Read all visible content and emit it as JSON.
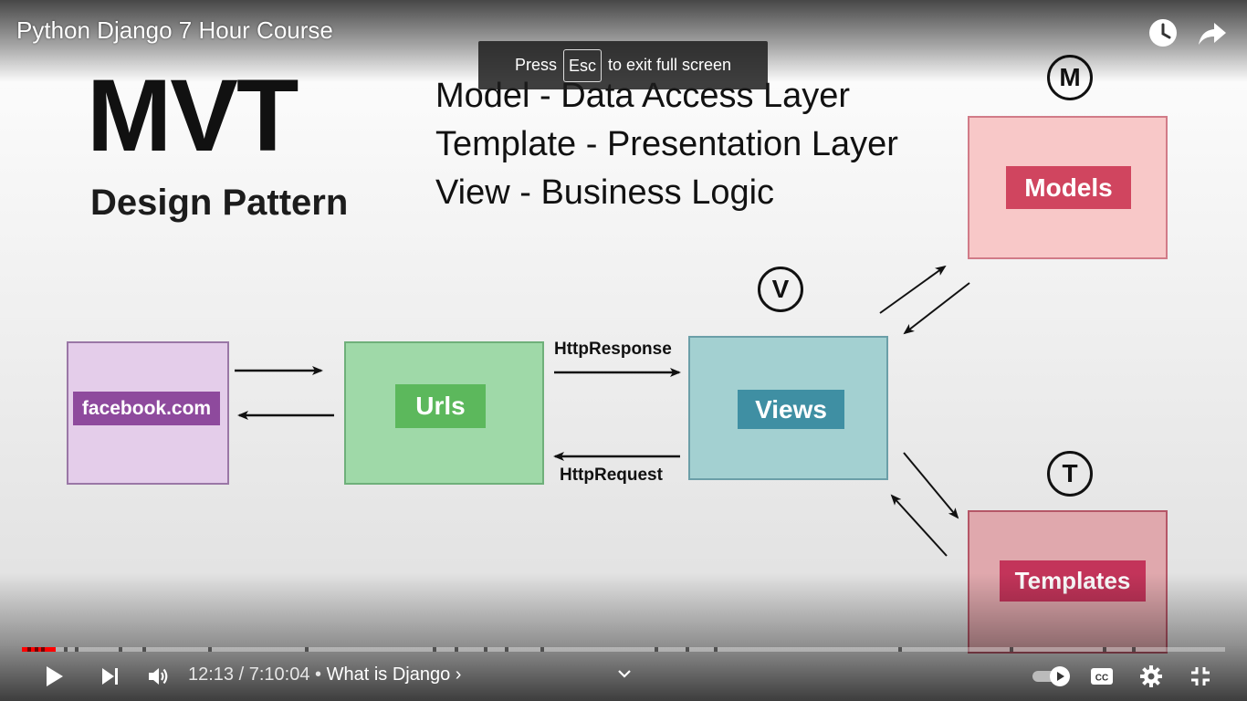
{
  "player": {
    "title": "Python Django 7 Hour Course",
    "fullscreen_toast": {
      "prefix": "Press",
      "key": "Esc",
      "suffix": "to exit full screen"
    },
    "time": {
      "current": "12:13",
      "separator": " / ",
      "total": "7:10:04",
      "bullet": " • ",
      "chapter": "What is Django",
      "chapter_chevron": "›"
    },
    "progress_fraction": 0.0284,
    "accent_color": "#ff0000",
    "icons": {
      "top_right": [
        "watch-later-icon",
        "share-icon"
      ],
      "bottom_left": [
        "play-icon",
        "next-icon",
        "volume-icon"
      ],
      "bottom_right": [
        "autoplay-toggle-icon",
        "captions-icon",
        "settings-icon",
        "exit-fullscreen-icon"
      ]
    }
  },
  "slide": {
    "heading": "MVT",
    "subheading": "Design Pattern",
    "legend": [
      "Model - Data Access Layer",
      "Template - Presentation Layer",
      "View - Business Logic"
    ],
    "nodes": {
      "client": {
        "label": "facebook.com",
        "fill": "#e4cdea",
        "border": "#9a77a6",
        "tag_color": "#8e4a9d"
      },
      "urls": {
        "label": "Urls",
        "fill": "#9fd9a8",
        "border": "#6fb07a",
        "tag_color": "#5cb85c"
      },
      "views": {
        "label": "Views",
        "badge": "V",
        "fill": "#a3d0d1",
        "border": "#6b9fa8",
        "tag_color": "#3f8fa3"
      },
      "models": {
        "label": "Models",
        "badge": "M",
        "fill": "#f8c8c8",
        "border": "#d17b88",
        "tag_color": "#d0455f"
      },
      "templates": {
        "label": "Templates",
        "badge": "T",
        "fill": "#e0a8ad",
        "border": "#b55667",
        "tag_color": "#c3345a"
      }
    },
    "edge_labels": {
      "response": "HttpResponse",
      "request": "HttpRequest"
    }
  }
}
